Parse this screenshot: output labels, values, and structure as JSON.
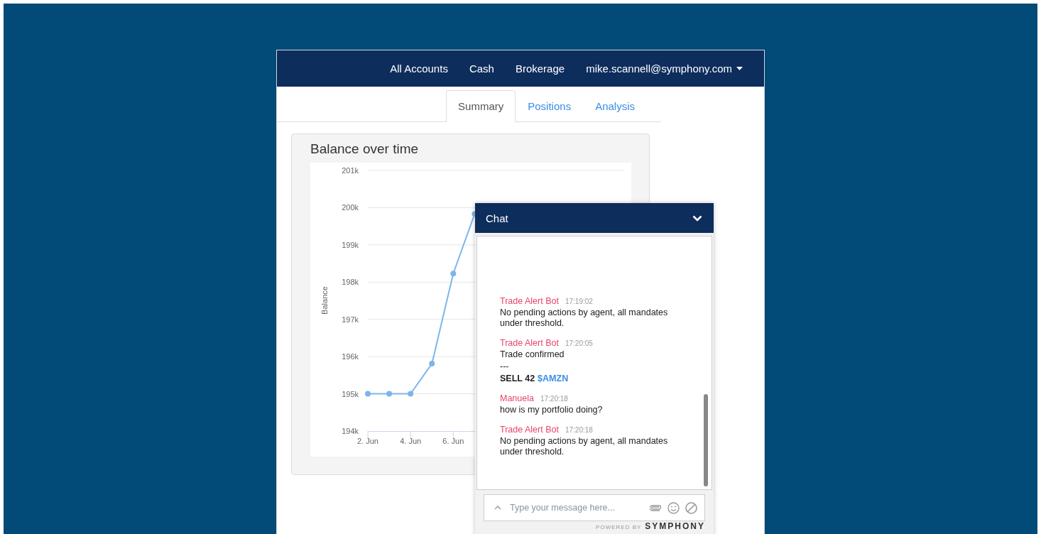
{
  "nav": {
    "items": [
      "All Accounts",
      "Cash",
      "Brokerage"
    ],
    "user": "mike.scannell@symphony.com"
  },
  "tabs": [
    {
      "label": "Summary",
      "selected": true
    },
    {
      "label": "Positions",
      "selected": false
    },
    {
      "label": "Analysis",
      "selected": false
    }
  ],
  "balance_card": {
    "title": "Balance over time",
    "chart_data": {
      "type": "line",
      "ylabel": "Balance",
      "categories": [
        "2. Jun",
        null,
        "4. Jun",
        null,
        "6. Jun",
        null,
        null,
        null,
        null,
        null,
        null,
        null,
        null
      ],
      "grid": true,
      "series": [
        {
          "color": "#7cb5ec",
          "marker": true,
          "values": [
            195000,
            195000,
            195000,
            195810,
            198230,
            199830,
            null,
            null,
            null,
            null,
            null,
            null,
            null
          ]
        }
      ],
      "ylim": [
        194000,
        201000
      ],
      "yticks": [
        {
          "value": 194000,
          "label": "194k"
        },
        {
          "value": 195000,
          "label": "195k"
        },
        {
          "value": 196000,
          "label": "196k"
        },
        {
          "value": 197000,
          "label": "197k"
        },
        {
          "value": 198000,
          "label": "198k"
        },
        {
          "value": 199000,
          "label": "199k"
        },
        {
          "value": 200000,
          "label": "200k"
        },
        {
          "value": 201000,
          "label": "201k"
        }
      ]
    }
  },
  "chat": {
    "title": "Chat",
    "messages": [
      {
        "sender": "Trade Alert Bot",
        "time": "17:19:02",
        "lines": [
          {
            "text": "No pending actions by agent, all mandates under threshold.",
            "bold": false
          }
        ]
      },
      {
        "sender": "Trade Alert Bot",
        "time": "17:20:05",
        "lines": [
          {
            "text": "Trade confirmed",
            "bold": false
          },
          {
            "text": "---",
            "bold": false
          },
          {
            "text": "SELL 42",
            "bold": true,
            "tag": "$AMZN"
          }
        ]
      },
      {
        "sender": "Manuela",
        "time": "17:20:18",
        "lines": [
          {
            "text": "how is my portfolio doing?",
            "bold": false
          }
        ]
      },
      {
        "sender": "Trade Alert Bot",
        "time": "17:20:18",
        "lines": [
          {
            "text": "No pending actions by agent, all mandates under threshold.",
            "bold": false
          }
        ]
      }
    ],
    "input": {
      "placeholder": "Type your message here..."
    },
    "footer": {
      "powered_by": "POWERED BY",
      "brand": "SYMPHONY"
    }
  }
}
